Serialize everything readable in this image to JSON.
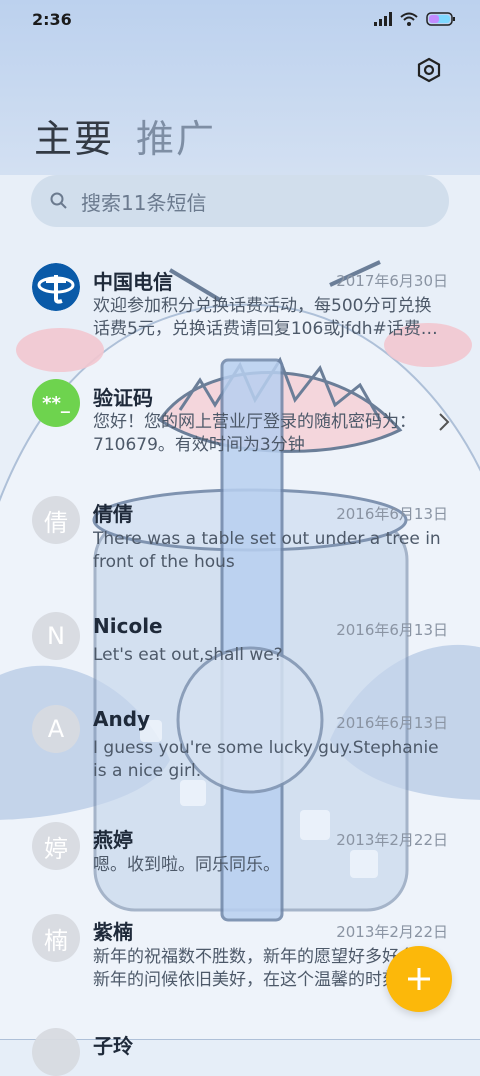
{
  "status_bar": {
    "time": "2:36",
    "icons": [
      "signal-icon",
      "wifi-icon",
      "battery-icon"
    ]
  },
  "header": {
    "settings_icon": "settings-icon",
    "tabs": [
      {
        "label": "主要",
        "active": true
      },
      {
        "label": "推广",
        "active": false
      }
    ]
  },
  "search": {
    "placeholder": "搜索11条短信",
    "icon": "search-icon"
  },
  "conversations": [
    {
      "name": "中国电信",
      "date": "2017年6月30日",
      "preview": "欢迎参加积分兑换话费活动，每500分可兑换话费5元，兑换话费请回复106或jfdh#话费金额",
      "avatar": {
        "type": "logo",
        "name": "china-telecom-logo-icon",
        "color": "#0a5aa8"
      }
    },
    {
      "name": "验证码",
      "date": "",
      "preview": "您好！您的网上营业厅登录的随机密码为：710679。有效时间为3分钟",
      "avatar": {
        "type": "text",
        "text": "**_",
        "color": "#6ed34e"
      },
      "has_chevron": true
    },
    {
      "name": "倩倩",
      "date": "2016年6月13日",
      "preview": "There was a table set out under a tree in front of the hous",
      "avatar": {
        "type": "letter",
        "text": "倩"
      }
    },
    {
      "name": "Nicole",
      "date": "2016年6月13日",
      "preview": "Let's eat out,shall we?",
      "avatar": {
        "type": "letter",
        "text": "N"
      }
    },
    {
      "name": "Andy",
      "date": "2016年6月13日",
      "preview": "I guess you're some lucky guy.Stephanie is a nice girl.",
      "avatar": {
        "type": "letter",
        "text": "A"
      }
    },
    {
      "name": "燕婷",
      "date": "2013年2月22日",
      "preview": "嗯。收到啦。同乐同乐。",
      "avatar": {
        "type": "letter",
        "text": "婷"
      }
    },
    {
      "name": "紫楠",
      "date": "2013年2月22日",
      "preview": "新年的祝福数不胜数，新年的愿望好多好多，新年的问候依旧美好，在这个温馨的时刻",
      "avatar": {
        "type": "letter",
        "text": "楠"
      }
    },
    {
      "name": "子玲",
      "date": "",
      "preview": "",
      "avatar": {
        "type": "letter",
        "text": ""
      }
    }
  ],
  "fab": {
    "icon": "plus-icon",
    "color": "#fcb80a"
  },
  "colors": {
    "background": "#e6eef8",
    "header_bg": "#c3d5ee",
    "accent": "#fcb80a"
  }
}
